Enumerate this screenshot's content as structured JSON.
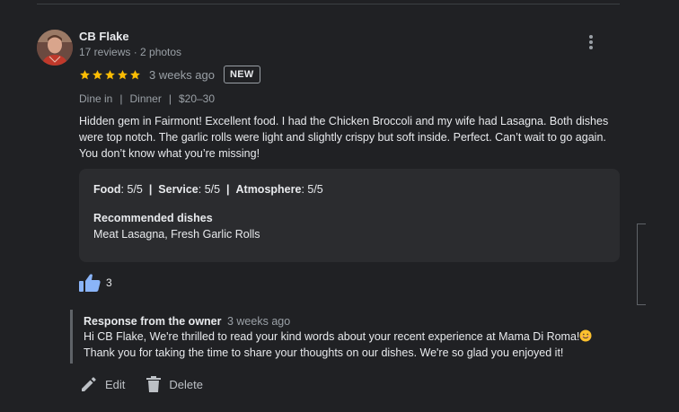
{
  "reviewer": {
    "name": "CB Flake",
    "meta": "17 reviews · 2 photos"
  },
  "review": {
    "stars": 5,
    "date": "3 weeks ago",
    "badge": "NEW",
    "visit": {
      "type": "Dine in",
      "meal": "Dinner",
      "price": "$20–30",
      "separator": "|"
    },
    "text": "Hidden gem in Fairmont!  Excellent food. I had the Chicken Broccoli and my wife had Lasagna. Both dishes were top notch. The garlic rolls were light and slightly crispy but soft inside. Perfect. Can’t wait to go again. You don’t know what you’re missing!",
    "ratings": {
      "food_label": "Food",
      "food_value": ": 5/5",
      "service_label": "Service",
      "service_value": ": 5/5",
      "atmosphere_label": "Atmosphere",
      "atmosphere_value": ": 5/5",
      "separator": "|"
    },
    "recommended": {
      "title": "Recommended dishes",
      "dishes": "Meat Lasagna, Fresh Garlic Rolls"
    },
    "likes": "3"
  },
  "owner_response": {
    "title": "Response from the owner",
    "date": "3 weeks ago",
    "line1": "Hi CB Flake, We're thrilled to read your kind words about your recent experience at Mama Di Roma!",
    "line2": "Thank you for taking the time to share your thoughts on our dishes. We're so glad you enjoyed it!"
  },
  "actions": {
    "edit_label": "Edit",
    "delete_label": "Delete"
  },
  "colors": {
    "background": "#202124",
    "card": "#2b2c2f",
    "star": "#fbbc04",
    "like_blue": "#8ab4f8",
    "muted_text": "#9aa0a6"
  },
  "icons": {
    "more": "more-vert-icon",
    "star": "star-icon",
    "like": "thumb-up-icon",
    "edit": "pencil-icon",
    "delete": "trash-icon",
    "emoji": "smiling-face-icon"
  }
}
